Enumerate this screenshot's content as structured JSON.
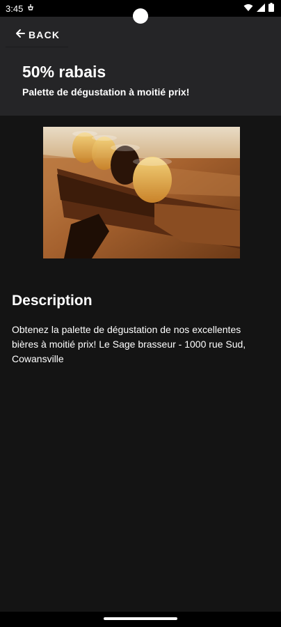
{
  "status_bar": {
    "time": "3:45",
    "icons": [
      "notification-icon",
      "wifi-icon",
      "signal-icon",
      "battery-icon"
    ]
  },
  "header": {
    "back_label": "BACK",
    "title": "50% rabais",
    "subtitle": "Palette de dégustation à moitié prix!"
  },
  "main": {
    "image_subject": "beer-tasting-flight-photo",
    "description_heading": "Description",
    "description_text": "Obtenez la palette de dégustation de nos excellentes bières à moitié prix! Le Sage brasseur - 1000 rue Sud, Cowansville"
  },
  "colors": {
    "header_bg": "#252527",
    "content_bg": "#141414",
    "text": "#ffffff"
  }
}
